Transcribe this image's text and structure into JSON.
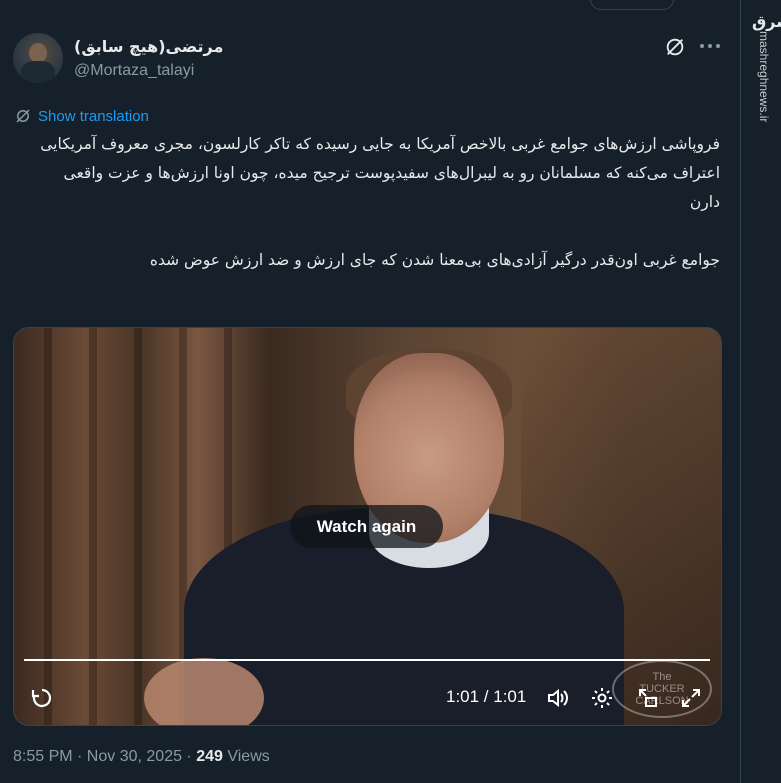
{
  "account": {
    "name": "مرتضی(هیچ سابق)",
    "handle": "@Mortaza_talayi"
  },
  "watermark": {
    "logo": "مشرق",
    "site": "mashreghnews.ir"
  },
  "translation": {
    "label": "Show translation"
  },
  "post": {
    "text": "فروپاشی ارزش‌های جوامع غربی بالاخص آمریکا به جایی رسیده که تاکر کارلسون، مجری معروف آمریکایی اعتراف می‌کنه که مسلمانان رو به لیبرال‌های سفیدپوست ترجیح میده، چون اونا ارزش‌ها و عزت واقعی دارن\n\nجوامع غربی اون‌قدر درگیر آزادی‌های بی‌معنا شدن که جای ارزش و ضد ارزش عوض شده"
  },
  "video": {
    "watch_again": "Watch again",
    "time": "1:01 / 1:01",
    "progress": 1.0,
    "logo_line1": "The",
    "logo_line2": "TUCKER",
    "logo_line3": "CARLSON"
  },
  "meta": {
    "date": "8:55 PM · Nov 30, 2025 · ",
    "views_count": "249",
    "views_label": " Views"
  },
  "colors": {
    "background": "#15202b",
    "accent": "#1d9bf0",
    "secondary_text": "#8b98a5"
  }
}
